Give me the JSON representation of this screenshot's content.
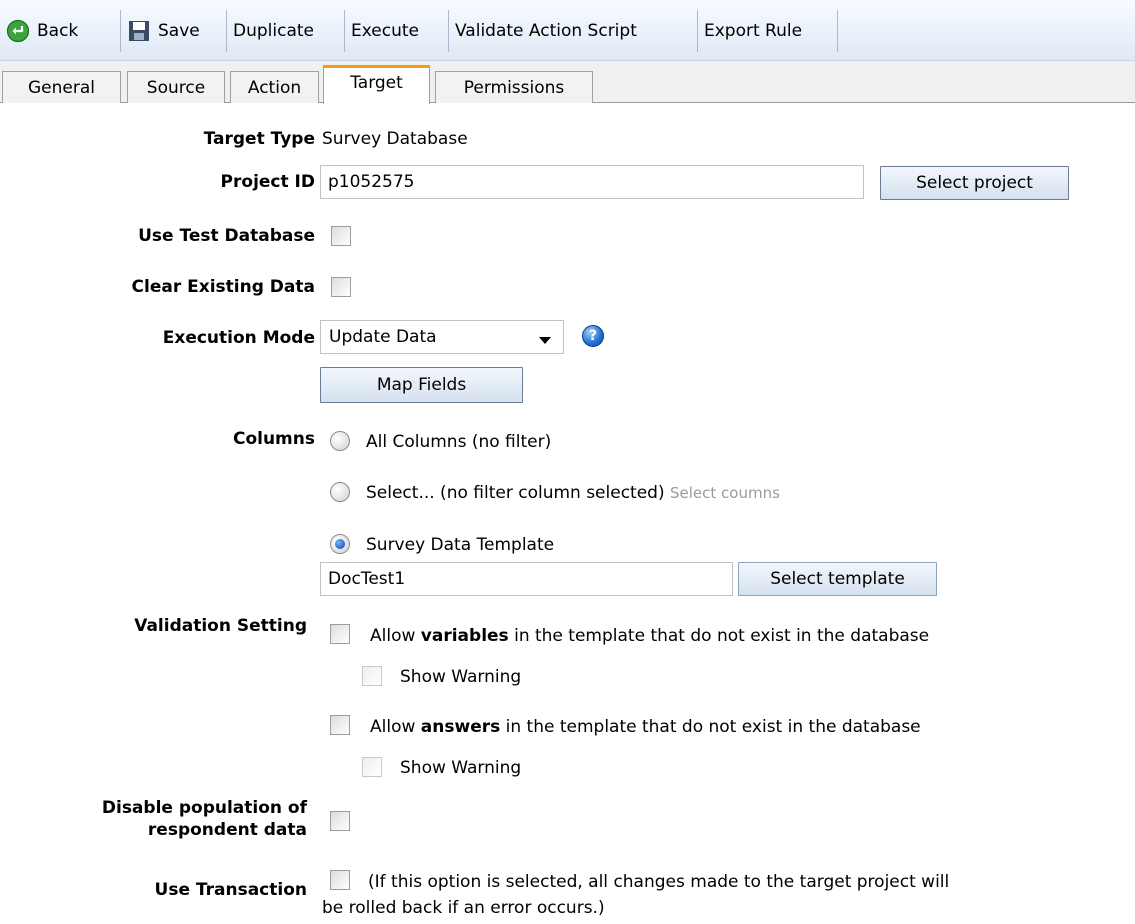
{
  "toolbar": {
    "back": "Back",
    "save": "Save",
    "duplicate": "Duplicate",
    "execute": "Execute",
    "validate": "Validate Action Script",
    "export": "Export Rule"
  },
  "tabs": [
    "General",
    "Source",
    "Action",
    "Target",
    "Permissions"
  ],
  "active_tab": "Target",
  "form": {
    "target_type_label": "Target Type",
    "target_type_value": "Survey Database",
    "project_id_label": "Project ID",
    "project_id_value": "p1052575",
    "select_project": "Select project",
    "use_test_db_label": "Use Test Database",
    "clear_data_label": "Clear Existing Data",
    "exec_mode_label": "Execution Mode",
    "exec_mode_value": "Update Data",
    "map_fields": "Map Fields",
    "columns_label": "Columns",
    "col_all": "All Columns (no filter)",
    "col_select": "Select... (no filter column selected)",
    "col_select_link": "Select coumns",
    "col_template": "Survey Data Template",
    "template_value": "DocTest1",
    "select_template": "Select template",
    "validation_label": "Validation Setting",
    "allow_vars_pre": "Allow ",
    "allow_vars_bold": "variables",
    "allow_vars_post": " in the template that do not exist in the database",
    "show_warning": "Show Warning",
    "allow_ans_pre": "Allow ",
    "allow_ans_bold": "answers",
    "allow_ans_post": " in the template that do not exist in the database",
    "disable_pop_line1": "Disable population of",
    "disable_pop_line2": "respondent data",
    "use_tx_label": "Use Transaction",
    "use_tx_note_line1": "(If this option is selected, all changes made to the target project will",
    "use_tx_note_line2": "be rolled back if an error occurs.)"
  },
  "state": {
    "columns_selected": "Survey Data Template",
    "use_test_db": false,
    "clear_existing": false,
    "allow_variables": false,
    "allow_answers": false,
    "disable_population": false,
    "use_transaction": false
  },
  "colors": {
    "toolbar_bg": "#e6eef8",
    "active_tab_accent": "#f39c12",
    "link_grey": "#9a9a9a"
  }
}
